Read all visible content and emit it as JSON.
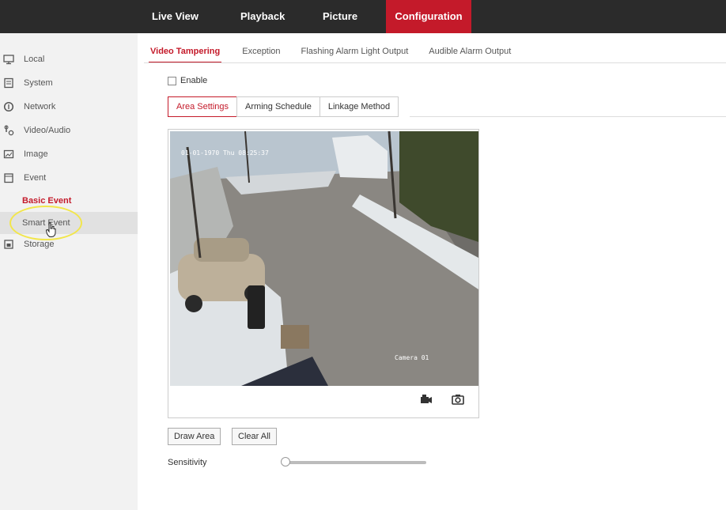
{
  "topnav": {
    "items": [
      {
        "label": "Live View"
      },
      {
        "label": "Playback"
      },
      {
        "label": "Picture"
      },
      {
        "label": "Configuration"
      }
    ],
    "active_index": 3
  },
  "sidebar": {
    "items": [
      {
        "label": "Local",
        "icon": "monitor-icon"
      },
      {
        "label": "System",
        "icon": "system-icon"
      },
      {
        "label": "Network",
        "icon": "network-icon"
      },
      {
        "label": "Video/Audio",
        "icon": "video-audio-icon"
      },
      {
        "label": "Image",
        "icon": "image-icon"
      },
      {
        "label": "Event",
        "icon": "event-icon"
      }
    ],
    "event_subitems": [
      {
        "label": "Basic Event",
        "active": true
      },
      {
        "label": "Smart Event",
        "hovered": true
      }
    ],
    "storage": {
      "label": "Storage",
      "icon": "storage-icon"
    }
  },
  "tabs": {
    "items": [
      {
        "label": "Video Tampering"
      },
      {
        "label": "Exception"
      },
      {
        "label": "Flashing Alarm Light Output"
      },
      {
        "label": "Audible Alarm Output"
      }
    ],
    "active_index": 0
  },
  "enable": {
    "label": "Enable",
    "checked": false
  },
  "subtabs": {
    "items": [
      {
        "label": "Area Settings"
      },
      {
        "label": "Arming Schedule"
      },
      {
        "label": "Linkage Method"
      }
    ],
    "active_index": 0
  },
  "video": {
    "osd_datetime": "01-01-1970 Thu 08:25:37",
    "osd_camera": "Camera 01"
  },
  "buttons": {
    "draw_area": "Draw Area",
    "clear_all": "Clear All"
  },
  "sensitivity": {
    "label": "Sensitivity",
    "value": 0
  },
  "colors": {
    "accent": "#c41a2a",
    "topbar": "#2b2b2b",
    "sidebar": "#f2f2f2"
  }
}
